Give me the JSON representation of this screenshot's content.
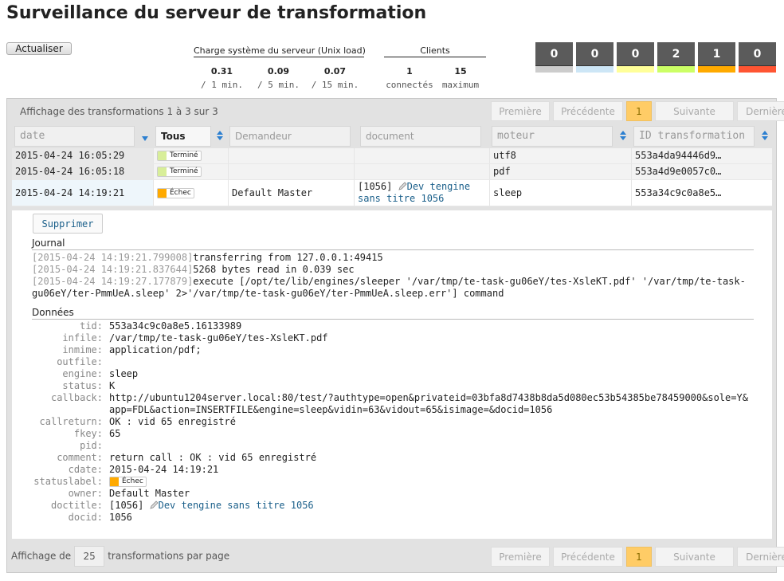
{
  "header": {
    "title": "Surveillance du serveur de transformation",
    "refresh_label": "Actualiser"
  },
  "load": {
    "heading": "Charge système du serveur (Unix load)",
    "items": [
      {
        "value": "0.31",
        "label": "/ 1 min."
      },
      {
        "value": "0.09",
        "label": "/ 5 min."
      },
      {
        "value": "0.07",
        "label": "/ 15 min."
      }
    ]
  },
  "clients": {
    "heading": "Clients",
    "items": [
      {
        "value": "1",
        "label": "connectés"
      },
      {
        "value": "15",
        "label": "maximum"
      }
    ]
  },
  "counters": [
    {
      "value": "0",
      "color": "#cccccc"
    },
    {
      "value": "0",
      "color": "#cde6f6"
    },
    {
      "value": "0",
      "color": "#ffff99"
    },
    {
      "value": "2",
      "color": "#ccff66"
    },
    {
      "value": "1",
      "color": "#ffaa00"
    },
    {
      "value": "0",
      "color": "#ff5533"
    }
  ],
  "list": {
    "info": "Affichage des transformations 1 à 3 sur 3",
    "pager": {
      "first": "Première",
      "prev": "Précédente",
      "page": "1",
      "next": "Suivante",
      "last": "Dernière"
    },
    "filters": {
      "date_placeholder": "date",
      "status_value": "Tous",
      "owner_placeholder": "Demandeur",
      "document_placeholder": "document",
      "engine_placeholder": "moteur",
      "id_placeholder": "ID transformation"
    },
    "rows": [
      {
        "date": "2015-04-24 16:05:29",
        "status": "Terminé",
        "status_color": "#d8ee99",
        "owner": "",
        "document": "",
        "engine": "utf8",
        "id": "553a4da94446d9…"
      },
      {
        "date": "2015-04-24 16:05:18",
        "status": "Terminé",
        "status_color": "#d8ee99",
        "owner": "",
        "document": "",
        "engine": "pdf",
        "id": "553a4d9e0057c0…"
      },
      {
        "date": "2015-04-24 14:19:21",
        "status": "Échec",
        "status_color": "#ffaa00",
        "owner": "Default Master",
        "doc_prefix": "[1056]",
        "doc_link_1": "Dev tengine",
        "doc_link_2": "sans titre 1056",
        "engine": "sleep",
        "id": "553a34c9c0a8e5…"
      }
    ]
  },
  "detail": {
    "delete_label": "Supprimer",
    "journal_heading": "Journal",
    "log": [
      {
        "ts": "[2015-04-24 14:19:21.799008]",
        "msg": "transferring from 127.0.0.1:49415"
      },
      {
        "ts": "[2015-04-24 14:19:21.837644]",
        "msg": "5268 bytes read in 0.039 sec"
      },
      {
        "ts": "[2015-04-24 14:19:27.177879]",
        "msg": "execute [/opt/te/lib/engines/sleeper '/var/tmp/te-task-gu06eY/tes-XsleKT.pdf' '/var/tmp/te-task-gu06eY/ter-PmmUeA.sleep' 2>'/var/tmp/te-task-gu06eY/ter-PmmUeA.sleep.err'] command"
      }
    ],
    "data_heading": "Données",
    "fields": [
      {
        "k": "tid:",
        "v": "553a34c9c0a8e5.16133989"
      },
      {
        "k": "infile:",
        "v": "/var/tmp/te-task-gu06eY/tes-XsleKT.pdf"
      },
      {
        "k": "inmime:",
        "v": "application/pdf;"
      },
      {
        "k": "outfile:",
        "v": ""
      },
      {
        "k": "engine:",
        "v": "sleep"
      },
      {
        "k": "status:",
        "v": "K"
      },
      {
        "k": "callback:",
        "v": "http://ubuntu1204server.local:80/test/?authtype=open&privateid=03bfa8d7438b8da5d080ec53b54385be78459000&sole=Y&app=FDL&action=INSERTFILE&engine=sleep&vidin=63&vidout=65&isimage=&docid=1056"
      },
      {
        "k": "callreturn:",
        "v": "OK : vid 65 enregistré"
      },
      {
        "k": "fkey:",
        "v": "65"
      },
      {
        "k": "pid:",
        "v": ""
      },
      {
        "k": "comment:",
        "v": "return call : OK : vid 65 enregistré"
      },
      {
        "k": "cdate:",
        "v": "2015-04-24 14:19:21"
      }
    ],
    "statuslabel_key": "statuslabel:",
    "statuslabel_value": "Échec",
    "owner_key": "owner:",
    "owner_value": "Default Master",
    "doctitle_key": "doctitle:",
    "doctitle_prefix": "[1056]",
    "doctitle_link": "Dev tengine sans titre 1056",
    "docid_key": "docid:",
    "docid_value": "1056"
  },
  "footer": {
    "prefix": "Affichage de",
    "page_size": "25",
    "suffix": "transformations par page",
    "pager": {
      "first": "Première",
      "prev": "Précédente",
      "page": "1",
      "next": "Suivante",
      "last": "Dernière"
    }
  }
}
